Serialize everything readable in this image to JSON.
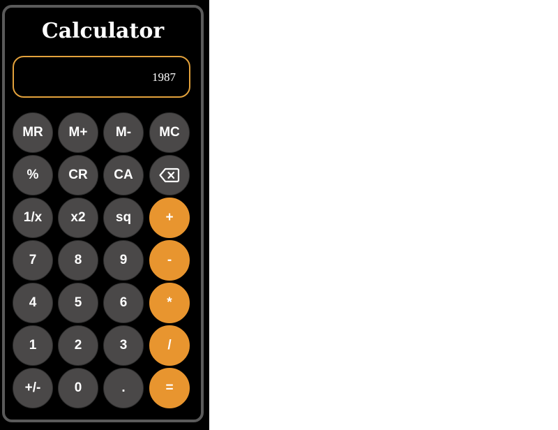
{
  "calculator": {
    "title": "Calculator",
    "display": "1987",
    "buttons": {
      "mr": "MR",
      "m_plus": "M+",
      "m_minus": "M-",
      "mc": "MC",
      "percent": "%",
      "cr": "CR",
      "ca": "CA",
      "backspace_icon": "backspace-icon",
      "reciprocal": "1/x",
      "square": "x2",
      "sqrt": "sq",
      "add": "+",
      "seven": "7",
      "eight": "8",
      "nine": "9",
      "subtract": "-",
      "four": "4",
      "five": "5",
      "six": "6",
      "multiply": "*",
      "one": "1",
      "two": "2",
      "three": "3",
      "divide": "/",
      "negate": "+/-",
      "zero": "0",
      "decimal": ".",
      "equals": "="
    },
    "colors": {
      "background": "#000000",
      "frame": "#5a5a5a",
      "display_border": "#e3a23c",
      "key": "#4a4848",
      "operator_key": "#e8952f",
      "text": "#ffffff"
    }
  }
}
